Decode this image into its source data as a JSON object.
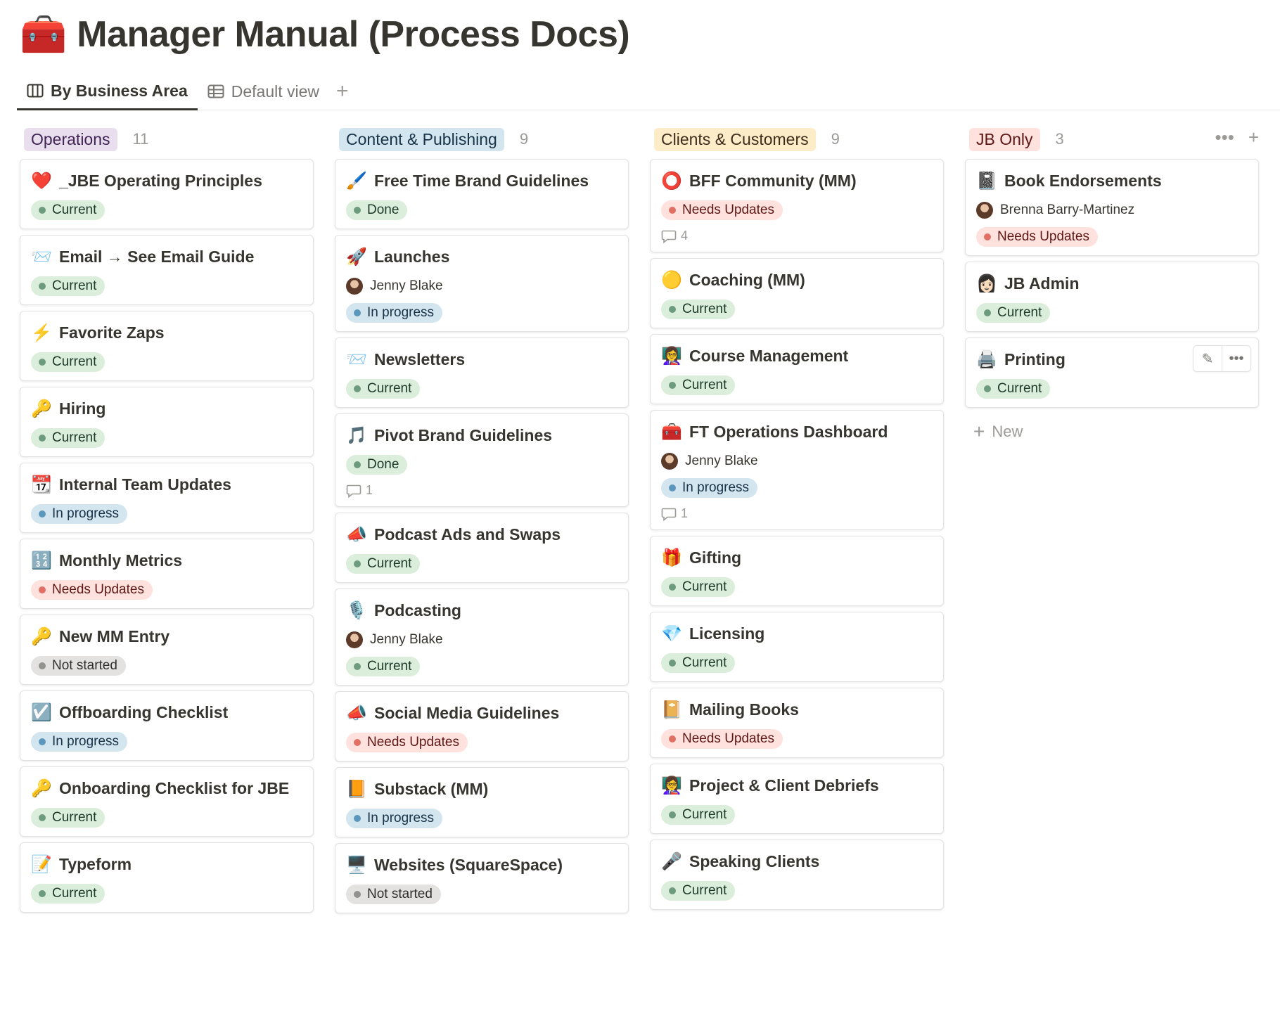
{
  "page": {
    "icon": "🧰",
    "title": "Manager Manual (Process Docs)"
  },
  "views": {
    "tabs": [
      {
        "label": "By Business Area",
        "icon": "board-view-icon",
        "active": true
      },
      {
        "label": "Default view",
        "icon": "table-view-icon",
        "active": false
      }
    ],
    "add": "+"
  },
  "colors": {
    "operations": "#e8deee",
    "content": "#d3e5ef",
    "clients": "#fdecc8",
    "jb": "#ffe2dd",
    "current": "#dbeddb",
    "in_progress": "#d3e5ef",
    "needs_updates": "#ffe2dd",
    "not_started": "#e3e2e0"
  },
  "columns": [
    {
      "name": "Operations",
      "count": "11",
      "tag_bg": "#e8deee",
      "tag_fg": "#412454",
      "cards": [
        {
          "icon": "❤️",
          "title": "_JBE Operating Principles",
          "status": "Current",
          "status_color": "green"
        },
        {
          "icon": "📨",
          "title": "Email → See Email Guide",
          "status": "Current",
          "status_color": "green"
        },
        {
          "icon": "⚡",
          "title": "Favorite Zaps",
          "status": "Current",
          "status_color": "green"
        },
        {
          "icon": "🔑",
          "title": "Hiring",
          "status": "Current",
          "status_color": "green"
        },
        {
          "icon": "📆",
          "title": "Internal Team Updates",
          "status": "In progress",
          "status_color": "blue"
        },
        {
          "icon": "🔢",
          "title": "Monthly Metrics",
          "status": "Needs Updates",
          "status_color": "red"
        },
        {
          "icon": "🔑",
          "title": "New MM Entry",
          "status": "Not started",
          "status_color": "gray"
        },
        {
          "icon": "☑️",
          "title": "Offboarding Checklist",
          "status": "In progress",
          "status_color": "blue"
        },
        {
          "icon": "🔑",
          "title": "Onboarding Checklist for JBE",
          "status": "Current",
          "status_color": "green"
        },
        {
          "icon": "📝",
          "title": "Typeform",
          "status": "Current",
          "status_color": "green"
        }
      ]
    },
    {
      "name": "Content & Publishing",
      "count": "9",
      "tag_bg": "#d3e5ef",
      "tag_fg": "#183347",
      "cards": [
        {
          "icon": "🖌️",
          "title": "Free Time Brand Guidelines",
          "status": "Done",
          "status_color": "green"
        },
        {
          "icon": "🚀",
          "title": "Launches",
          "person": "Jenny Blake",
          "status": "In progress",
          "status_color": "blue"
        },
        {
          "icon": "📨",
          "title": "Newsletters",
          "status": "Current",
          "status_color": "green"
        },
        {
          "icon": "🎵",
          "title": "Pivot Brand Guidelines",
          "status": "Done",
          "status_color": "green",
          "comments": "1"
        },
        {
          "icon": "📣",
          "title": "Podcast Ads and Swaps",
          "status": "Current",
          "status_color": "green"
        },
        {
          "icon": "🎙️",
          "title": "Podcasting",
          "person": "Jenny Blake",
          "status": "Current",
          "status_color": "green"
        },
        {
          "icon": "📣",
          "title": "Social Media Guidelines",
          "status": "Needs Updates",
          "status_color": "red"
        },
        {
          "icon": "📙",
          "title": "Substack (MM)",
          "status": "In progress",
          "status_color": "blue"
        },
        {
          "icon": "🖥️",
          "title": "Websites (SquareSpace)",
          "status": "Not started",
          "status_color": "gray"
        }
      ]
    },
    {
      "name": "Clients & Customers",
      "count": "9",
      "tag_bg": "#fdecc8",
      "tag_fg": "#402c1b",
      "cards": [
        {
          "icon": "⭕",
          "title": "BFF Community (MM)",
          "status": "Needs Updates",
          "status_color": "red",
          "comments": "4"
        },
        {
          "icon": "🟡",
          "title": "Coaching (MM)",
          "status": "Current",
          "status_color": "green"
        },
        {
          "icon": "👩‍🏫",
          "title": "Course Management",
          "status": "Current",
          "status_color": "green"
        },
        {
          "icon": "🧰",
          "title": "FT Operations Dashboard",
          "person": "Jenny Blake",
          "status": "In progress",
          "status_color": "blue",
          "comments": "1"
        },
        {
          "icon": "🎁",
          "title": "Gifting",
          "status": "Current",
          "status_color": "green"
        },
        {
          "icon": "💎",
          "title": "Licensing",
          "status": "Current",
          "status_color": "green"
        },
        {
          "icon": "📔",
          "title": "Mailing Books",
          "status": "Needs Updates",
          "status_color": "red"
        },
        {
          "icon": "👩‍🏫",
          "title": "Project & Client Debriefs",
          "status": "Current",
          "status_color": "green"
        },
        {
          "icon": "🎤",
          "title": "Speaking Clients",
          "status": "Current",
          "status_color": "green"
        }
      ]
    },
    {
      "name": "JB Only",
      "count": "3",
      "tag_bg": "#ffe2dd",
      "tag_fg": "#5d1715",
      "actions": {
        "more": "•••",
        "add": "+"
      },
      "cards": [
        {
          "icon": "📓",
          "title": "Book Endorsements",
          "person": "Brenna Barry-Martinez",
          "status": "Needs Updates",
          "status_color": "red"
        },
        {
          "icon": "👩🏻",
          "title": "JB Admin",
          "status": "Current",
          "status_color": "green"
        },
        {
          "icon": "🖨️",
          "title": "Printing",
          "status": "Current",
          "status_color": "green",
          "hover_tools": true
        }
      ],
      "new_label": "New"
    }
  ]
}
